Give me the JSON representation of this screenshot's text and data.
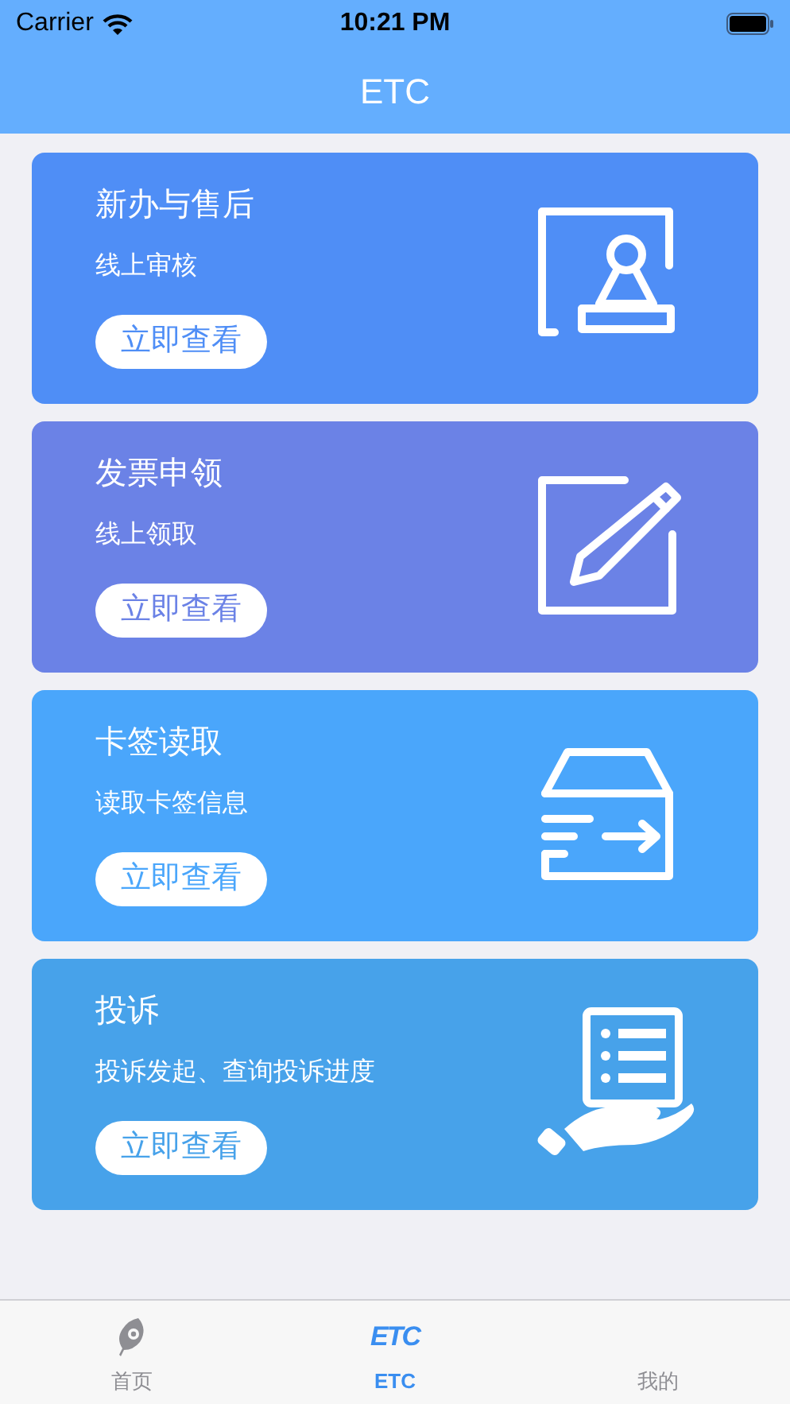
{
  "status_bar": {
    "carrier": "Carrier",
    "time": "10:21 PM"
  },
  "nav_bar": {
    "title": "ETC"
  },
  "cards": [
    {
      "kind": "stamp",
      "title": "新办与售后",
      "subtitle": "线上审核",
      "button": "立即查看",
      "color": "#4f8ef6"
    },
    {
      "kind": "pencil",
      "title": "发票申领",
      "subtitle": "线上领取",
      "button": "立即查看",
      "color": "#6b82e6"
    },
    {
      "kind": "box",
      "title": "卡签读取",
      "subtitle": "读取卡签信息",
      "button": "立即查看",
      "color": "#4aa6fb"
    },
    {
      "kind": "hand",
      "title": "投诉",
      "subtitle": "投诉发起、查询投诉进度",
      "button": "立即查看",
      "color": "#47a2ea"
    }
  ],
  "tab_bar": [
    {
      "kind": "feather",
      "label": "首页",
      "selected": false
    },
    {
      "kind": "text",
      "icon_text": "ETC",
      "label": "ETC",
      "selected": true
    },
    {
      "kind": "none",
      "label": "我的",
      "selected": false
    }
  ]
}
